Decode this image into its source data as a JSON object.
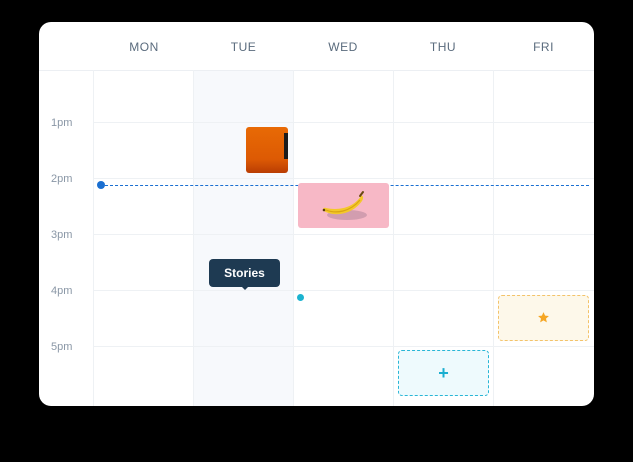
{
  "days": [
    "MON",
    "TUE",
    "WED",
    "THU",
    "FRI"
  ],
  "times": [
    "1pm",
    "2pm",
    "3pm",
    "4pm",
    "5pm"
  ],
  "tooltip": {
    "label": "Stories"
  },
  "add_slot": {
    "icon": "plus-icon",
    "symbol": "+"
  },
  "star_slot": {
    "icon": "star-icon"
  },
  "colors": {
    "now_indicator": "#1a6fd1",
    "tooltip_bg": "#1e3a52",
    "add_slot_accent": "#29b6d6",
    "star_accent": "#f5a623",
    "banana_card_bg": "#f7b8c6"
  }
}
